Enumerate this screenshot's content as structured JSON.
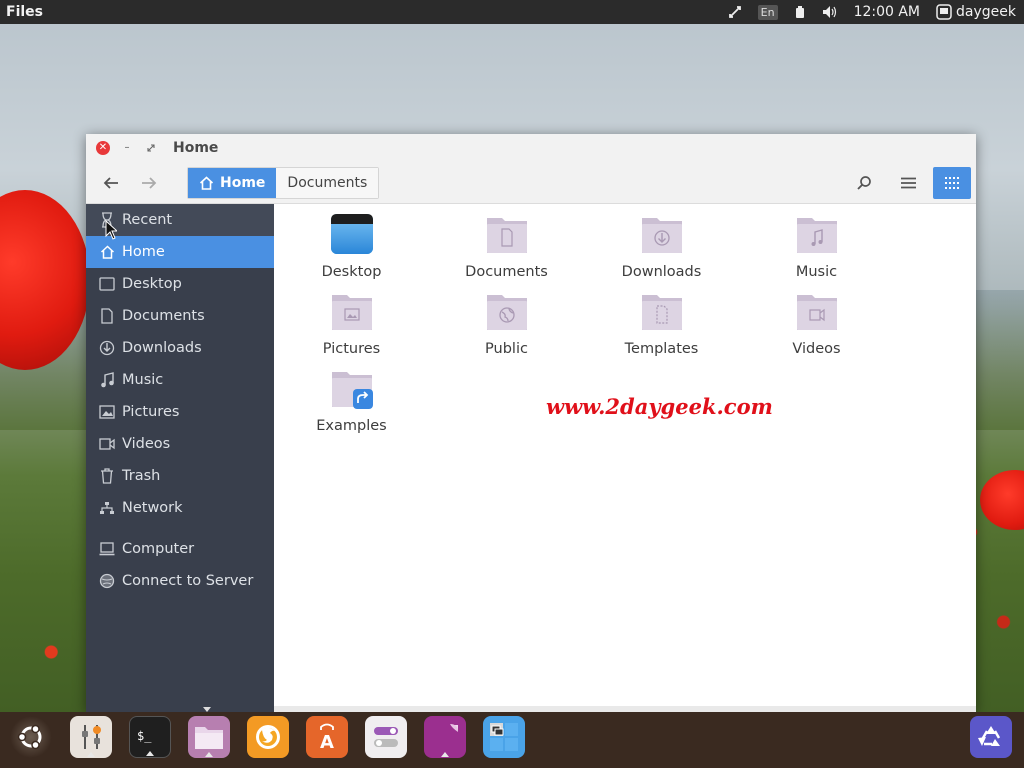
{
  "top_panel": {
    "app_title": "Files",
    "keyboard_layout": "En",
    "clock": "12:00 AM",
    "user": "daygeek"
  },
  "window": {
    "title": "Home",
    "breadcrumbs": [
      {
        "label": "Home",
        "active": true
      },
      {
        "label": "Documents",
        "active": false
      }
    ]
  },
  "sidebar": {
    "items": [
      {
        "label": "Recent",
        "icon": "clock-icon"
      },
      {
        "label": "Home",
        "icon": "home-icon",
        "active": true
      },
      {
        "label": "Desktop",
        "icon": "desktop-icon"
      },
      {
        "label": "Documents",
        "icon": "document-icon"
      },
      {
        "label": "Downloads",
        "icon": "download-icon"
      },
      {
        "label": "Music",
        "icon": "music-icon"
      },
      {
        "label": "Pictures",
        "icon": "picture-icon"
      },
      {
        "label": "Videos",
        "icon": "video-icon"
      },
      {
        "label": "Trash",
        "icon": "trash-icon"
      },
      {
        "label": "Network",
        "icon": "network-icon"
      }
    ],
    "devices": [
      {
        "label": "Computer",
        "icon": "computer-icon"
      },
      {
        "label": "Connect to Server",
        "icon": "server-icon"
      }
    ]
  },
  "files": [
    {
      "name": "Desktop",
      "icon": "desktop-folder-icon"
    },
    {
      "name": "Documents",
      "icon": "documents-folder-icon"
    },
    {
      "name": "Downloads",
      "icon": "downloads-folder-icon"
    },
    {
      "name": "Music",
      "icon": "music-folder-icon"
    },
    {
      "name": "Pictures",
      "icon": "pictures-folder-icon"
    },
    {
      "name": "Public",
      "icon": "public-folder-icon"
    },
    {
      "name": "Templates",
      "icon": "templates-folder-icon"
    },
    {
      "name": "Videos",
      "icon": "videos-folder-icon"
    },
    {
      "name": "Examples",
      "icon": "examples-folder-icon"
    }
  ],
  "watermark": "www.2daygeek.com",
  "dock": [
    {
      "name": "ubuntu-logo-icon"
    },
    {
      "name": "system-settings-icon"
    },
    {
      "name": "terminal-icon"
    },
    {
      "name": "files-icon"
    },
    {
      "name": "firefox-icon"
    },
    {
      "name": "software-center-icon"
    },
    {
      "name": "tweak-tool-icon"
    },
    {
      "name": "text-editor-icon"
    },
    {
      "name": "workspaces-icon"
    },
    {
      "name": "trash-icon"
    }
  ],
  "colors": {
    "accent": "#4a90e2",
    "sidebar_bg": "#393f4c",
    "panel_bg": "#2b2b2b",
    "close_button": "#e8393a",
    "folder": "#d9cfe0",
    "watermark": "#e0101a"
  }
}
